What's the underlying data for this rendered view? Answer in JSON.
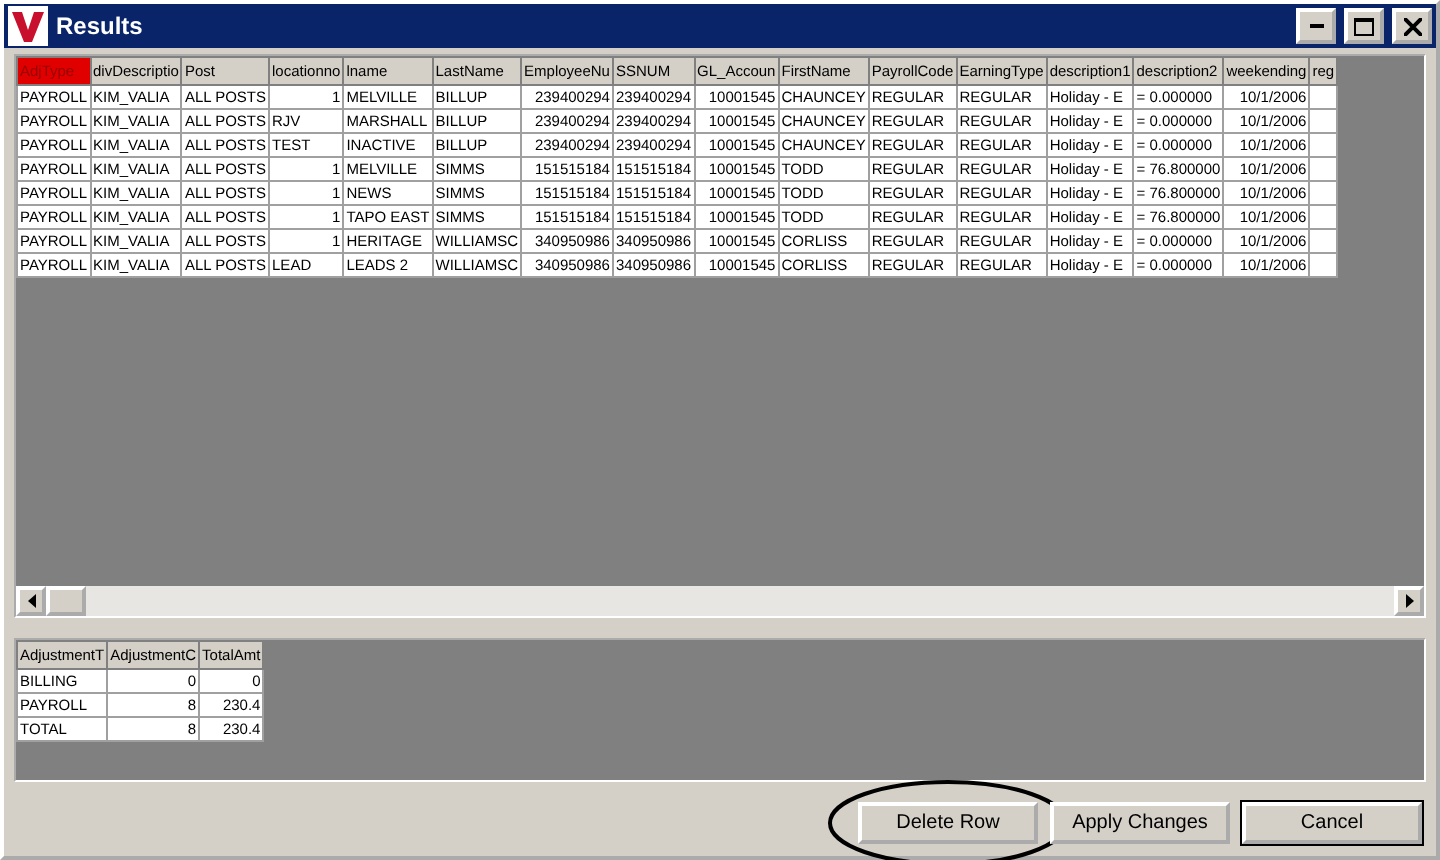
{
  "window": {
    "title": "Results"
  },
  "results_table": {
    "columns": [
      {
        "label": "AdjType",
        "selected": true
      },
      {
        "label": "divDescriptio",
        "selected": false
      },
      {
        "label": "Post",
        "selected": false
      },
      {
        "label": "locationno",
        "selected": false,
        "numeric": true
      },
      {
        "label": "lname",
        "selected": false
      },
      {
        "label": "LastName",
        "selected": false
      },
      {
        "label": "EmployeeNu",
        "selected": false,
        "numeric": true
      },
      {
        "label": "SSNUM",
        "selected": false
      },
      {
        "label": "GL_Accoun",
        "selected": false,
        "numeric": true
      },
      {
        "label": "FirstName",
        "selected": false
      },
      {
        "label": "PayrollCode",
        "selected": false
      },
      {
        "label": "EarningType",
        "selected": false
      },
      {
        "label": "description1",
        "selected": false
      },
      {
        "label": "description2",
        "selected": false
      },
      {
        "label": "weekending",
        "selected": false,
        "numeric": true
      },
      {
        "label": "reg",
        "selected": false
      }
    ],
    "rows": [
      [
        "PAYROLL",
        "KIM_VALIA",
        "ALL POSTS",
        "1",
        "MELVILLE",
        "BILLUP",
        "239400294",
        "239400294",
        "10001545",
        "CHAUNCEY",
        "REGULAR",
        "REGULAR",
        "Holiday - E",
        "= 0.000000",
        "10/1/2006",
        ""
      ],
      [
        "PAYROLL",
        "KIM_VALIA",
        "ALL POSTS",
        "RJV",
        "MARSHALL",
        "BILLUP",
        "239400294",
        "239400294",
        "10001545",
        "CHAUNCEY",
        "REGULAR",
        "REGULAR",
        "Holiday - E",
        "= 0.000000",
        "10/1/2006",
        ""
      ],
      [
        "PAYROLL",
        "KIM_VALIA",
        "ALL POSTS",
        "TEST",
        "INACTIVE",
        "BILLUP",
        "239400294",
        "239400294",
        "10001545",
        "CHAUNCEY",
        "REGULAR",
        "REGULAR",
        "Holiday - E",
        "= 0.000000",
        "10/1/2006",
        ""
      ],
      [
        "PAYROLL",
        "KIM_VALIA",
        "ALL POSTS",
        "1",
        "MELVILLE",
        "SIMMS",
        "151515184",
        "151515184",
        "10001545",
        "TODD",
        "REGULAR",
        "REGULAR",
        "Holiday - E",
        "= 76.800000",
        "10/1/2006",
        ""
      ],
      [
        "PAYROLL",
        "KIM_VALIA",
        "ALL POSTS",
        "1",
        "NEWS",
        "SIMMS",
        "151515184",
        "151515184",
        "10001545",
        "TODD",
        "REGULAR",
        "REGULAR",
        "Holiday - E",
        "= 76.800000",
        "10/1/2006",
        ""
      ],
      [
        "PAYROLL",
        "KIM_VALIA",
        "ALL POSTS",
        "1",
        "TAPO EAST",
        "SIMMS",
        "151515184",
        "151515184",
        "10001545",
        "TODD",
        "REGULAR",
        "REGULAR",
        "Holiday - E",
        "= 76.800000",
        "10/1/2006",
        ""
      ],
      [
        "PAYROLL",
        "KIM_VALIA",
        "ALL POSTS",
        "1",
        "HERITAGE",
        "WILLIAMSC",
        "340950986",
        "340950986",
        "10001545",
        "CORLISS",
        "REGULAR",
        "REGULAR",
        "Holiday - E",
        "= 0.000000",
        "10/1/2006",
        ""
      ],
      [
        "PAYROLL",
        "KIM_VALIA",
        "ALL POSTS",
        "LEAD",
        "LEADS 2",
        "WILLIAMSC",
        "340950986",
        "340950986",
        "10001545",
        "CORLISS",
        "REGULAR",
        "REGULAR",
        "Holiday - E",
        "= 0.000000",
        "10/1/2006",
        ""
      ]
    ]
  },
  "summary_table": {
    "columns": [
      {
        "label": "AdjustmentT",
        "selected": false
      },
      {
        "label": "AdjustmentC",
        "selected": false,
        "numeric": true
      },
      {
        "label": "TotalAmt",
        "selected": false,
        "numeric": true
      }
    ],
    "rows": [
      [
        "BILLING",
        "0",
        "0"
      ],
      [
        "PAYROLL",
        "8",
        "230.4"
      ],
      [
        "TOTAL",
        "8",
        "230.4"
      ]
    ]
  },
  "buttons": [
    {
      "label": "Delete Row",
      "circled": true,
      "default": false
    },
    {
      "label": "Apply Changes",
      "circled": false,
      "default": false
    },
    {
      "label": "Cancel",
      "circled": false,
      "default": true
    }
  ]
}
